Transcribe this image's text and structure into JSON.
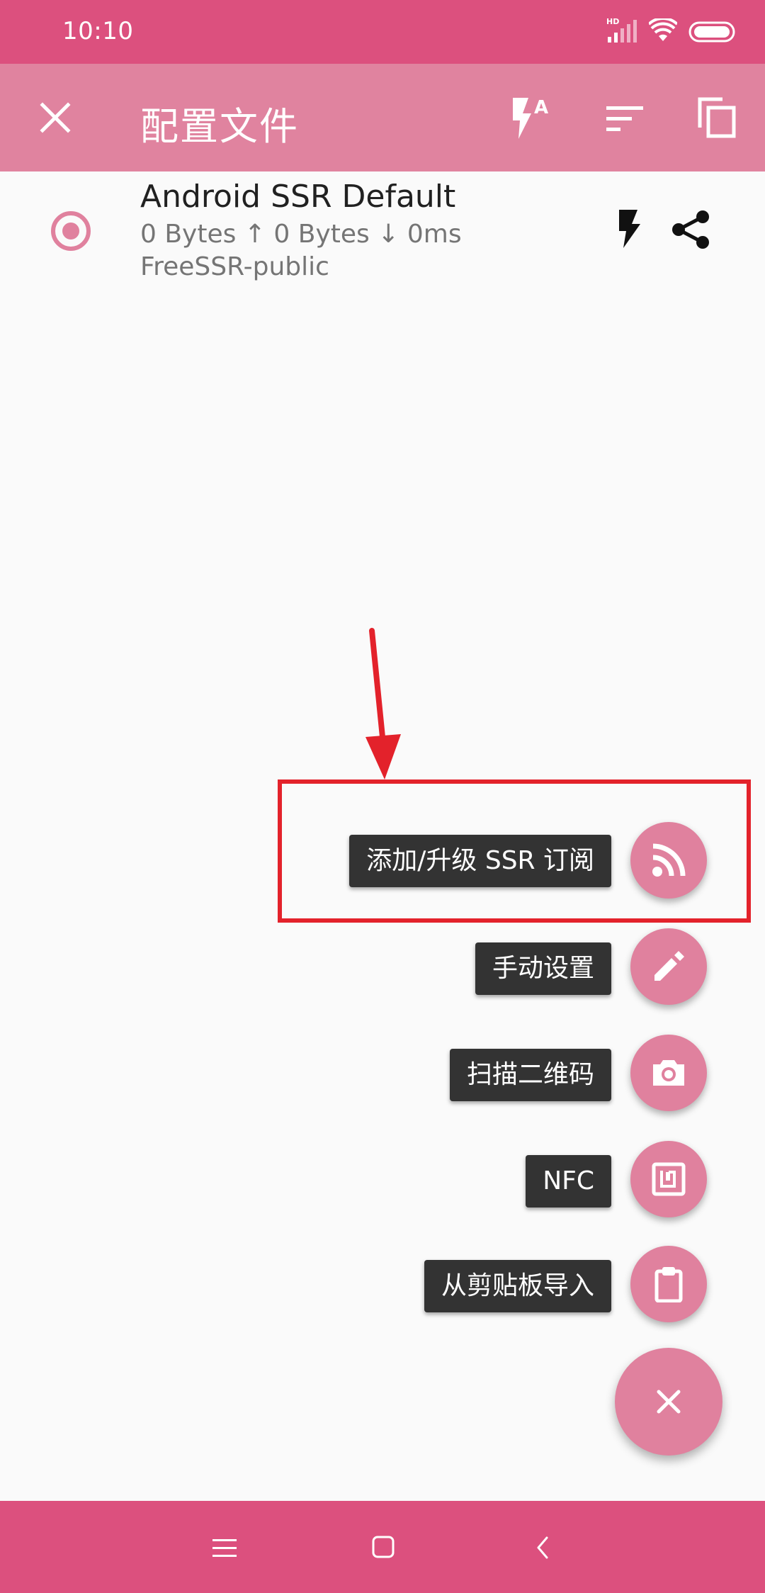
{
  "status_bar": {
    "time": "10:10",
    "network_badge": "HD",
    "icons": [
      "signal-icon",
      "wifi-icon",
      "battery-icon"
    ]
  },
  "app_bar": {
    "title": "配置文件",
    "actions": [
      "close-icon",
      "test-all-icon",
      "sort-icon",
      "copy-icon"
    ]
  },
  "profiles": [
    {
      "name": "Android SSR Default",
      "stats": "0 Bytes ↑  0 Bytes ↓  0ms",
      "group": "FreeSSR-public",
      "selected": true
    }
  ],
  "fab_menu": {
    "items": [
      {
        "label": "添加/升级 SSR 订阅",
        "icon": "rss-icon"
      },
      {
        "label": "手动设置",
        "icon": "pencil-icon"
      },
      {
        "label": "扫描二维码",
        "icon": "camera-icon"
      },
      {
        "label": "NFC",
        "icon": "nfc-icon"
      },
      {
        "label": "从剪贴板导入",
        "icon": "clipboard-icon"
      }
    ],
    "main_icon": "close-icon"
  },
  "nav_bar": {
    "icons": [
      "menu-icon",
      "home-icon",
      "back-icon"
    ]
  },
  "colors": {
    "status_bar": "#dc507e",
    "app_bar": "#e0839f",
    "accent": "#e0819e",
    "annotation": "#e3222b",
    "tooltip": "#333333",
    "background": "#fafafa"
  }
}
